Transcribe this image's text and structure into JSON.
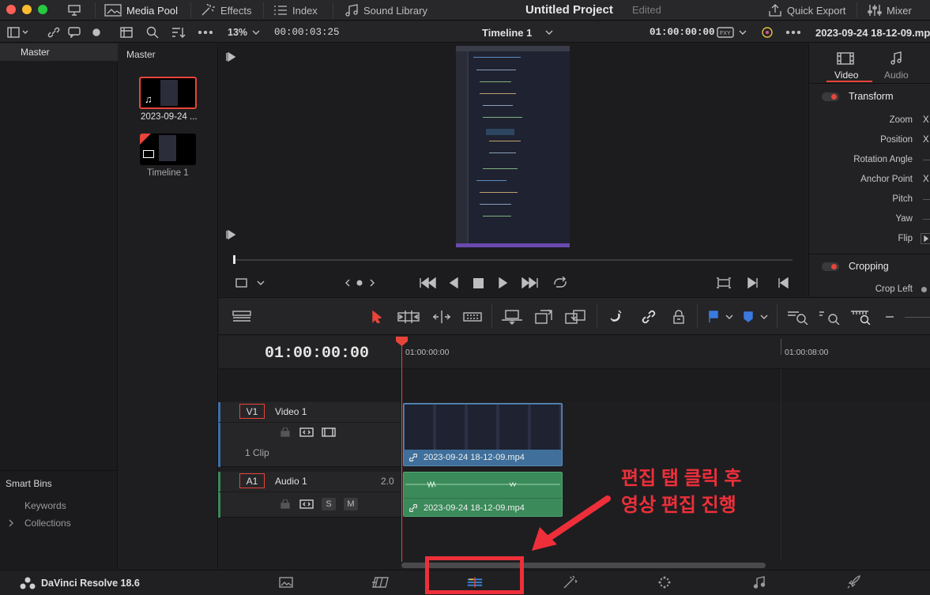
{
  "titlebar": {
    "media_pool": "Media Pool",
    "effects": "Effects",
    "index": "Index",
    "sound_library": "Sound Library",
    "project_title": "Untitled Project",
    "status": "Edited",
    "quick_export": "Quick Export",
    "mixer": "Mixer"
  },
  "toolbar": {
    "zoom": "13%",
    "timecode": "00:00:03:25",
    "timeline_name": "Timeline 1",
    "viewer_timecode": "01:00:00:00",
    "clip_name": "2023-09-24 18-12-09.mp4"
  },
  "bins": {
    "master": "Master",
    "smart_bins": "Smart Bins",
    "keywords": "Keywords",
    "collections": "Collections"
  },
  "media_pool": {
    "header": "Master",
    "clips": [
      {
        "label": "2023-09-24 ..."
      },
      {
        "label": "Timeline 1"
      }
    ]
  },
  "inspector": {
    "tab_video": "Video",
    "tab_audio": "Audio",
    "transform": "Transform",
    "zoom": "Zoom",
    "position": "Position",
    "rotation": "Rotation Angle",
    "anchor": "Anchor Point",
    "pitch": "Pitch",
    "yaw": "Yaw",
    "flip": "Flip",
    "x": "X",
    "cropping": "Cropping",
    "crop_left": "Crop Left"
  },
  "timeline": {
    "timecode": "01:00:00:00",
    "ruler_start": "01:00:00:00",
    "ruler_end": "01:00:08:00",
    "video_track_id": "V1",
    "video_track_name": "Video 1",
    "video_clip_count": "1 Clip",
    "audio_track_id": "A1",
    "audio_track_name": "Audio 1",
    "audio_level": "2.0",
    "solo": "S",
    "mute": "M",
    "video_clip_name": "2023-09-24 18-12-09.mp4",
    "audio_clip_name": "2023-09-24 18-12-09.mp4"
  },
  "annotation": {
    "line1": "편집 탭 클릭 후",
    "line2": "영상 편집 진행"
  },
  "footer": {
    "app_name": "DaVinci Resolve 18.6"
  },
  "colors": {
    "accent_red": "#e8443a",
    "video_clip": "#3f6f9a",
    "audio_clip": "#3b8a5a",
    "annotation": "#ee2f3a"
  }
}
